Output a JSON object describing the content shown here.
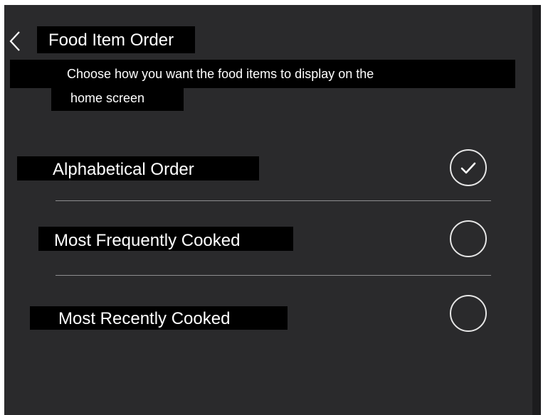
{
  "header": {
    "title": "Food Item Order",
    "description_line1": "Choose how you want the food items to display on the",
    "description_line2": "home screen"
  },
  "options": [
    {
      "label": "Alphabetical Order",
      "selected": true
    },
    {
      "label": "Most Frequently Cooked",
      "selected": false
    },
    {
      "label": "Most Recently Cooked",
      "selected": false
    }
  ],
  "icons": {
    "back": "chevron-left-icon",
    "selected": "check-icon"
  },
  "colors": {
    "background": "#2a2a2c",
    "label_background": "#000000",
    "text": "#ffffff",
    "divider": "#8e8e90"
  }
}
